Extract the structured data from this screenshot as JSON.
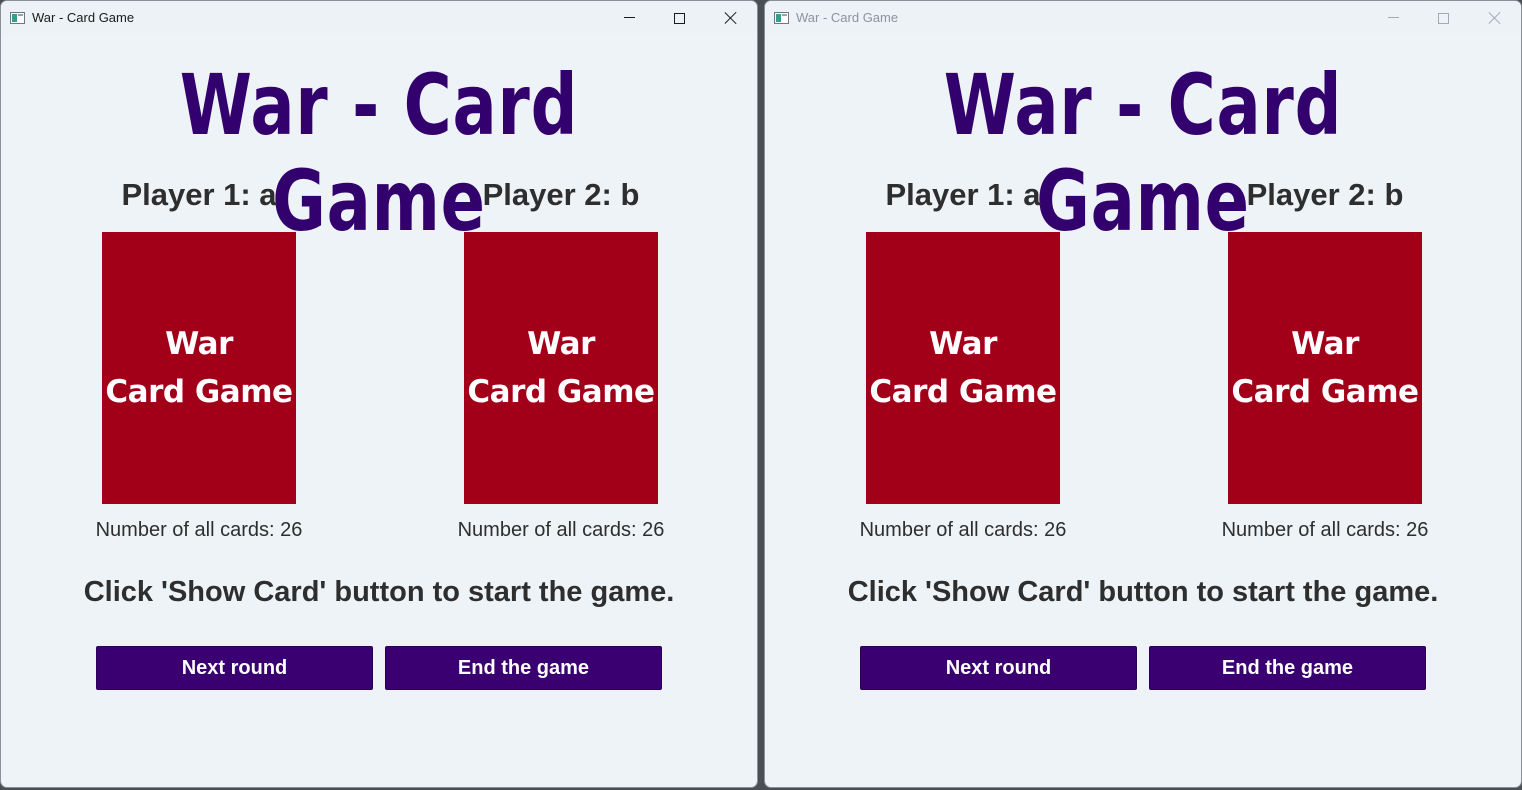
{
  "windows": [
    {
      "state": "active",
      "title": "War - Card Game",
      "heading": "War - Card Game",
      "players": [
        {
          "name": "Player 1: a",
          "card_line1": "War",
          "card_line2": "Card Game",
          "count": "Number of all cards: 26"
        },
        {
          "name": "Player 2: b",
          "card_line1": "War",
          "card_line2": "Card Game",
          "count": "Number of all cards: 26"
        }
      ],
      "status": "Click 'Show Card' button to start the game.",
      "buttons": {
        "next": "Next round",
        "end": "End the game"
      }
    },
    {
      "state": "inactive",
      "title": "War - Card Game",
      "heading": "War - Card Game",
      "players": [
        {
          "name": "Player 1: a",
          "card_line1": "War",
          "card_line2": "Card Game",
          "count": "Number of all cards: 26"
        },
        {
          "name": "Player 2: b",
          "card_line1": "War",
          "card_line2": "Card Game",
          "count": "Number of all cards: 26"
        }
      ],
      "status": "Click 'Show Card' button to start the game.",
      "buttons": {
        "next": "Next round",
        "end": "End the game"
      }
    }
  ],
  "colors": {
    "heading": "#33016d",
    "card_back": "#a20019",
    "button": "#3a0072",
    "window_bg": "#edf3f6"
  },
  "icons": [
    "app-icon",
    "minimize-icon",
    "maximize-icon",
    "close-icon"
  ]
}
